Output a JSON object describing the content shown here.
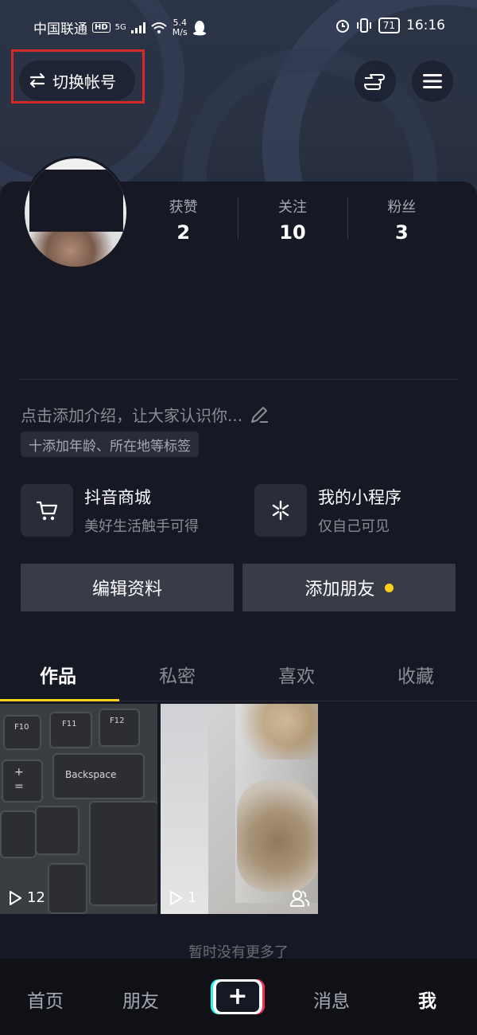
{
  "status_bar": {
    "carrier": "中国联通",
    "hd": "HD",
    "network": "5G",
    "speed_value": "5.4",
    "speed_unit": "M/s",
    "battery": "71",
    "time": "16:16"
  },
  "header": {
    "switch_account": "切换帐号"
  },
  "profile": {
    "stats": [
      {
        "label": "获赞",
        "value": "2"
      },
      {
        "label": "关注",
        "value": "10"
      },
      {
        "label": "粉丝",
        "value": "3"
      }
    ],
    "intro_placeholder": "点击添加介绍，让大家认识你...",
    "tag_chip": "十添加年龄、所在地等标签"
  },
  "cards": [
    {
      "title": "抖音商城",
      "subtitle": "美好生活触手可得",
      "icon": "cart-icon"
    },
    {
      "title": "我的小程序",
      "subtitle": "仅自己可见",
      "icon": "mini-program-icon"
    }
  ],
  "actions": {
    "edit_profile": "编辑资料",
    "add_friend": "添加朋友"
  },
  "tabs": [
    "作品",
    "私密",
    "喜欢",
    "收藏"
  ],
  "videos": [
    {
      "plays": "12"
    },
    {
      "plays": "1"
    }
  ],
  "keyboard_keys": [
    "F10",
    "F11",
    "F12",
    "+",
    "=",
    "Backspace"
  ],
  "no_more": "暂时没有更多了",
  "bottom_nav": {
    "home": "首页",
    "friends": "朋友",
    "messages": "消息",
    "me": "我"
  },
  "colors": {
    "accent": "#fcd018",
    "background": "#161823"
  }
}
